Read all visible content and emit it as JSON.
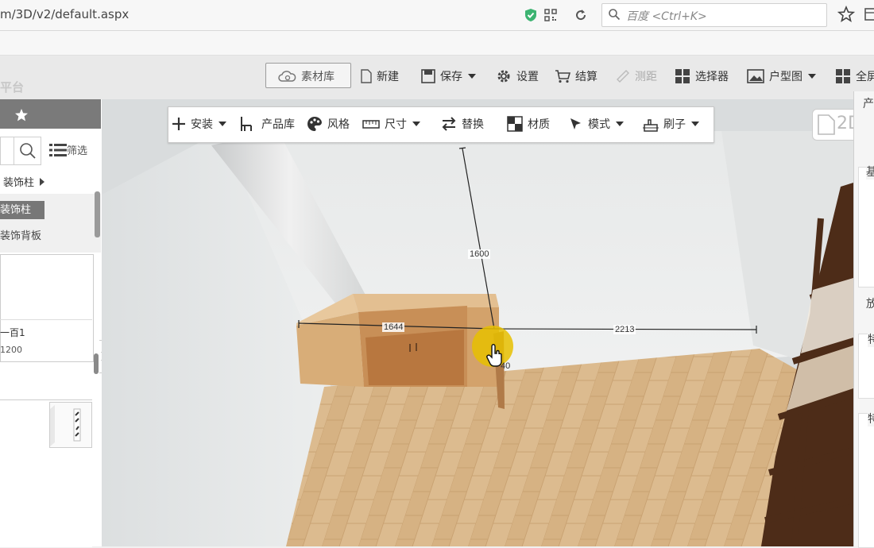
{
  "browser": {
    "url": "m/3D/v2/default.aspx",
    "search_placeholder": "百度 <Ctrl+K>"
  },
  "app": {
    "platform_label": "平台"
  },
  "toolbar": {
    "material_lib": "素材库",
    "new": "新建",
    "save": "保存",
    "settings": "设置",
    "checkout": "结算",
    "measure": "测距",
    "selector": "选择器",
    "floorplan": "户型图",
    "fullscreen": "全屏"
  },
  "float_toolbar": {
    "install": "安装",
    "product_lib": "产品库",
    "style": "风格",
    "size": "尺寸",
    "replace": "替换",
    "material": "材质",
    "mode": "模式",
    "brush": "刷子"
  },
  "left_panel": {
    "filter": "筛选",
    "category_path": "装饰柱",
    "categories": [
      "装饰柱",
      "装饰背板"
    ],
    "product_name": "一百1",
    "product_size": "1200",
    "collapse_glyph": "》"
  },
  "viewport": {
    "view_2d_label": "2D",
    "dimensions": {
      "height": "1600",
      "left_width": "1644",
      "right_width": "2213",
      "depth": "40"
    }
  },
  "right_panel": {
    "labels": [
      "产",
      "基",
      "放",
      "特",
      "特"
    ]
  },
  "colors": {
    "toolbar_bg": "#e9e9e9",
    "panel_header": "#7a7a7a",
    "wood_light": "#d9b38a",
    "wood_dark": "#5a3a22",
    "cursor_highlight": "#e6c000"
  }
}
